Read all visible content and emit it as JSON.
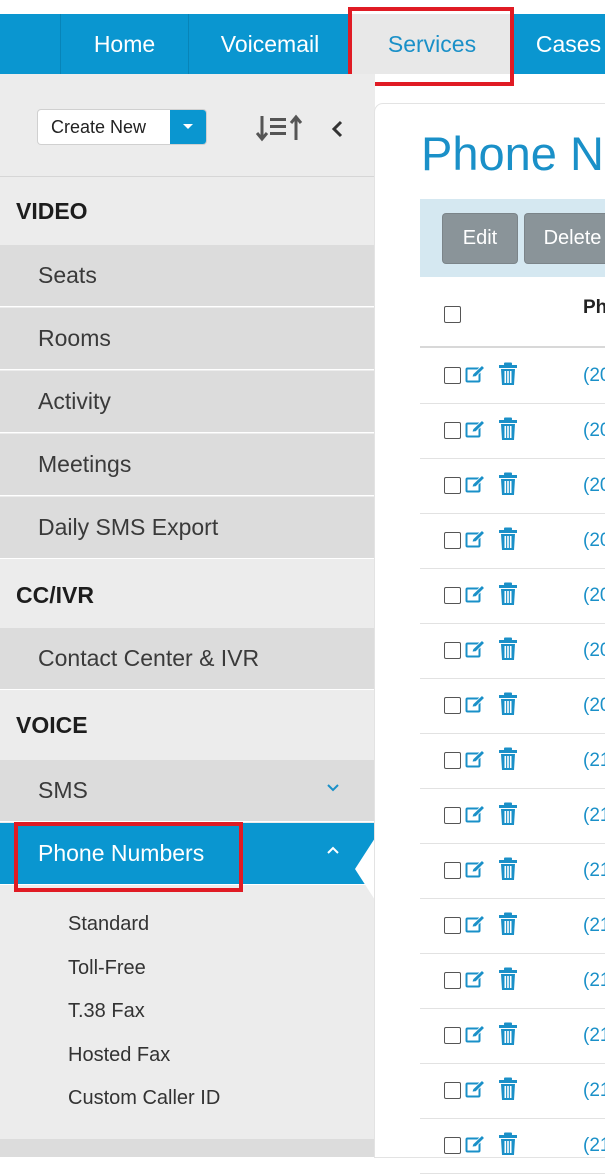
{
  "nav": {
    "items": [
      {
        "label": "Home"
      },
      {
        "label": "Voicemail"
      },
      {
        "label": "Services"
      },
      {
        "label": "Cases"
      }
    ],
    "active": "Services"
  },
  "toolbar": {
    "create_new_label": "Create New",
    "icons": [
      "sort-icon",
      "collapse-left-icon"
    ]
  },
  "sidebar": {
    "sections": [
      {
        "title": "VIDEO",
        "items": [
          "Seats",
          "Rooms",
          "Activity",
          "Meetings",
          "Daily SMS Export"
        ]
      },
      {
        "title": "CC/IVR",
        "items": [
          "Contact Center & IVR"
        ]
      },
      {
        "title": "VOICE",
        "items": [
          "SMS",
          "Phone Numbers"
        ]
      }
    ],
    "active_item": "Phone Numbers",
    "phone_numbers_subitems": [
      "Standard",
      "Toll-Free",
      "T.38 Fax",
      "Hosted Fax",
      "Custom Caller ID"
    ]
  },
  "main": {
    "title": "Phone Nu",
    "buttons": {
      "edit": "Edit",
      "delete": "Delete"
    },
    "table": {
      "column_phone": "Ph",
      "rows": [
        "(20",
        "(20",
        "(20",
        "(20",
        "(20",
        "(20",
        "(20",
        "(21",
        "(21",
        "(21",
        "(21",
        "(21",
        "(21",
        "(21",
        "(21"
      ]
    }
  },
  "colors": {
    "brand_blue": "#0a96d0",
    "link_blue": "#1a90c8",
    "highlight_red": "#e01b24",
    "button_gray": "#8a9499"
  }
}
